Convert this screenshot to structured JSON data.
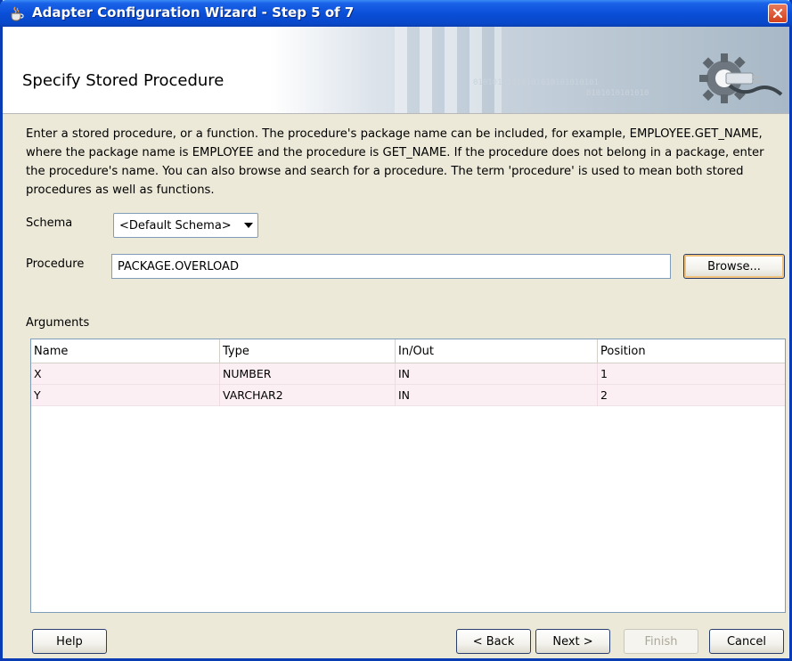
{
  "window": {
    "title": "Adapter Configuration Wizard - Step 5 of 7",
    "icons": {
      "app": "java-cup-icon",
      "close": "close-icon"
    }
  },
  "banner": {
    "title": "Specify Stored Procedure",
    "binary_line1": "01010101010101010101010101",
    "binary_line2": "0101010101010"
  },
  "description": "Enter a stored procedure, or a function. The procedure's package name can be included, for example, EMPLOYEE.GET_NAME, where the package name is EMPLOYEE and the procedure is GET_NAME.  If the procedure does not belong in a package, enter the procedure's name. You can also browse and search for a procedure. The term 'procedure' is used to mean both stored procedures as well as functions.",
  "schema": {
    "label": "Schema",
    "selected": "<Default Schema>"
  },
  "procedure": {
    "label": "Procedure",
    "value": "PACKAGE.OVERLOAD",
    "browse_label": "Browse..."
  },
  "arguments": {
    "label": "Arguments",
    "columns": [
      "Name",
      "Type",
      "In/Out",
      "Position"
    ],
    "rows": [
      [
        "X",
        "NUMBER",
        "IN",
        "1"
      ],
      [
        "Y",
        "VARCHAR2",
        "IN",
        "2"
      ]
    ]
  },
  "footer": {
    "help_label": "Help",
    "back_label": "< Back",
    "next_label": "Next >",
    "finish_label": "Finish",
    "cancel_label": "Cancel"
  }
}
